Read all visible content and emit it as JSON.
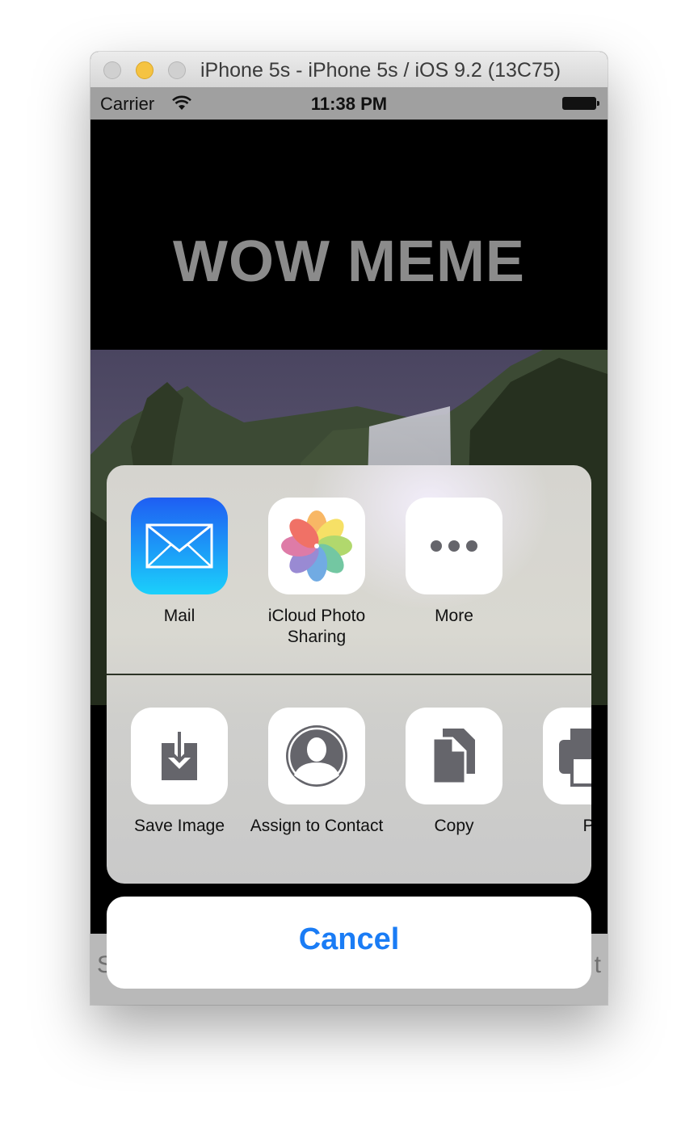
{
  "window": {
    "title": "iPhone 5s - iPhone 5s / iOS 9.2 (13C75)"
  },
  "status_bar": {
    "carrier": "Carrier",
    "time": "11:38 PM"
  },
  "meme": {
    "top_text": "WOW MEME"
  },
  "toolbar": {
    "left_partial": "S",
    "right_partial": "t"
  },
  "share_sheet": {
    "apps": [
      {
        "label": "Mail",
        "icon": "mail-icon"
      },
      {
        "label": "iCloud Photo Sharing",
        "icon": "photos-icon"
      },
      {
        "label": "More",
        "icon": "more-icon"
      }
    ],
    "actions": [
      {
        "label": "Save Image",
        "icon": "save-image-icon"
      },
      {
        "label": "Assign to Contact",
        "icon": "contact-icon"
      },
      {
        "label": "Copy",
        "icon": "copy-icon"
      },
      {
        "label": "Pr",
        "icon": "print-icon"
      }
    ],
    "cancel": "Cancel"
  },
  "colors": {
    "accent": "#1a7cf5",
    "mail_gradient_top": "#1e5ef3",
    "mail_gradient_bottom": "#1bd0fb",
    "action_icon": "#65656b"
  }
}
